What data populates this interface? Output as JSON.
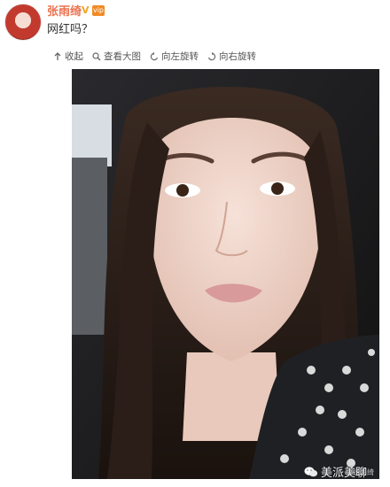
{
  "author": {
    "name": "张雨绮",
    "member_badge": "vip"
  },
  "post": {
    "text": "网红吗？"
  },
  "toolbar": {
    "collapse": "收起",
    "view_large": "查看大图",
    "rotate_left": "向左旋转",
    "rotate_right": "向右旋转"
  },
  "photo": {
    "corner_watermark": "@张雨绮",
    "brand_watermark": "美派美聊"
  },
  "colors": {
    "author_name": "#eb7350",
    "verified": "#f5a623",
    "member_badge": "#f08a24",
    "toolbar_text": "#555555"
  },
  "icons": {
    "collapse": "arrow-up-icon",
    "view_large": "magnifier-icon",
    "rotate_left": "rotate-left-icon",
    "rotate_right": "rotate-right-icon",
    "brand": "wechat-icon"
  }
}
